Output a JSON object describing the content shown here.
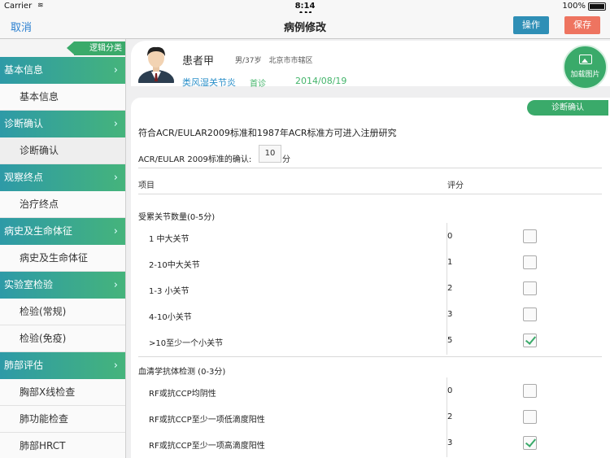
{
  "status": {
    "carrier": "Carrier",
    "time": "8:14 AM",
    "battery": "100%"
  },
  "nav": {
    "cancel": "取消",
    "title": "病例修改",
    "op": "操作",
    "save": "保存"
  },
  "sidebar": {
    "tag": "逻辑分类",
    "items": [
      {
        "label": "基本信息",
        "type": "cat"
      },
      {
        "label": "基本信息",
        "type": "sub"
      },
      {
        "label": "诊断确认",
        "type": "cat"
      },
      {
        "label": "诊断确认",
        "type": "sub"
      },
      {
        "label": "观察终点",
        "type": "cat"
      },
      {
        "label": "治疗终点",
        "type": "sub"
      },
      {
        "label": "病史及生命体征",
        "type": "cat"
      },
      {
        "label": "病史及生命体征",
        "type": "sub"
      },
      {
        "label": "实验室检验",
        "type": "cat"
      },
      {
        "label": "检验(常规)",
        "type": "sub"
      },
      {
        "label": "检验(免疫)",
        "type": "sub"
      },
      {
        "label": "肺部评估",
        "type": "cat"
      },
      {
        "label": "胸部X线检查",
        "type": "sub"
      },
      {
        "label": "肺功能检查",
        "type": "sub"
      },
      {
        "label": "肺部HRCT",
        "type": "sub"
      }
    ]
  },
  "patient": {
    "name": "患者甲",
    "meta": "男/37岁　北京市市辖区",
    "diagnosis": "类风湿关节炎",
    "visit": "首诊",
    "date": "2014/08/19",
    "load_image": "加载图片"
  },
  "form": {
    "confirm_btn": "诊断确认",
    "intro": "符合ACR/EULAR2009标准和1987年ACR标准方可进入注册研究",
    "score_label": "ACR/EULAR 2009标准的确认:",
    "score_value": "10",
    "score_unit": "分",
    "col_item": "项目",
    "col_score": "评分",
    "sections": [
      {
        "title": "受累关节数量(0-5分)",
        "rows": [
          {
            "label": "1  中大关节",
            "score": "0",
            "checked": false
          },
          {
            "label": "2-10中大关节",
            "score": "1",
            "checked": false
          },
          {
            "label": "1-3  小关节",
            "score": "2",
            "checked": false
          },
          {
            "label": "4-10小关节",
            "score": "3",
            "checked": false
          },
          {
            "label": ">10至少一个小关节",
            "score": "5",
            "checked": true
          }
        ]
      },
      {
        "title": "血清学抗体检测 (0-3分)",
        "rows": [
          {
            "label": "RF或抗CCP均阴性",
            "score": "0",
            "checked": false
          },
          {
            "label": "RF或抗CCP至少一项低滴度阳性",
            "score": "2",
            "checked": false
          },
          {
            "label": "RF或抗CCP至少一项高滴度阳性",
            "score": "3",
            "checked": true
          }
        ]
      }
    ]
  }
}
